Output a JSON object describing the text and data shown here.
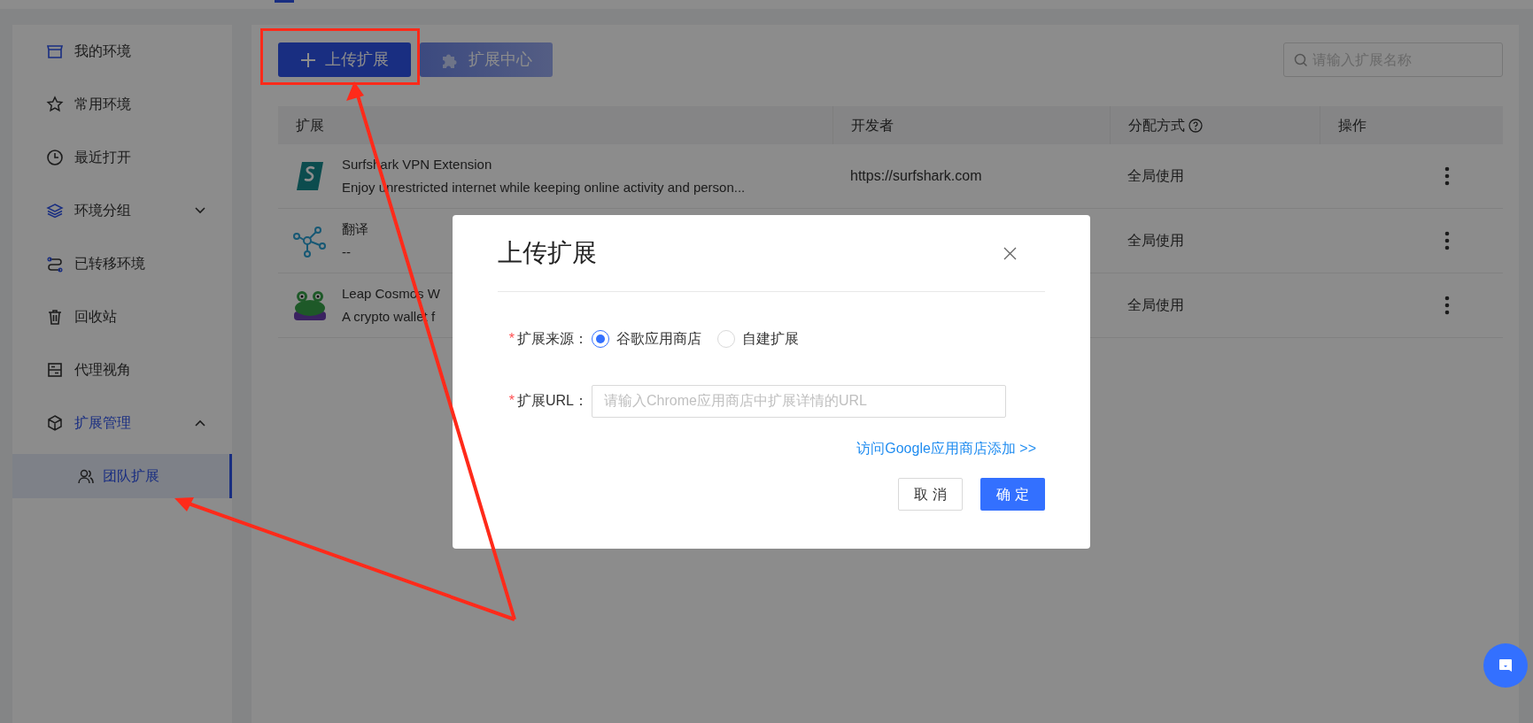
{
  "sidebar": {
    "items": [
      {
        "label": "我的环境",
        "selected": false
      },
      {
        "label": "常用环境",
        "selected": false
      },
      {
        "label": "最近打开",
        "selected": false
      },
      {
        "label": "环境分组",
        "selected": false,
        "expanded": false
      },
      {
        "label": "已转移环境",
        "selected": false
      },
      {
        "label": "回收站",
        "selected": false
      },
      {
        "label": "代理视角",
        "selected": false
      },
      {
        "label": "扩展管理",
        "selected": true,
        "expanded": true,
        "children": [
          {
            "label": "团队扩展",
            "selected": true,
            "marked": true
          }
        ]
      }
    ]
  },
  "toolbar": {
    "buttons": [
      {
        "label": "上传扩展",
        "kind": "primary",
        "marked": true
      },
      {
        "label": "扩展中心",
        "kind": "gradient"
      }
    ],
    "search": {
      "placeholder": "请输入扩展名称"
    }
  },
  "table": {
    "columns": [
      {
        "label": "扩展"
      },
      {
        "label": "开发者"
      },
      {
        "label": "分配方式",
        "help": true
      },
      {
        "label": "操作"
      }
    ],
    "rows": [
      {
        "name": "Surfshark VPN Extension",
        "description": "Enjoy unrestricted internet while keeping online activity and person...",
        "developer": "https://surfshark.com",
        "assignment": "全局使用"
      },
      {
        "name": "翻译",
        "description": "--",
        "assignment": "全局使用"
      },
      {
        "name": "Leap Cosmos W",
        "description": "A crypto wallet f",
        "assignment": "全局使用"
      }
    ]
  },
  "dialog": {
    "title": "上传扩展",
    "source": {
      "label": "扩展来源：",
      "required_mark": "*",
      "options": [
        {
          "label": "谷歌应用商店",
          "selected": true
        },
        {
          "label": "自建扩展",
          "selected": false
        }
      ]
    },
    "url": {
      "label": "扩展URL：",
      "required_mark": "*",
      "placeholder": "请输入Chrome应用商店中扩展详情的URL"
    },
    "link": "访问Google应用商店添加 >>",
    "buttons": [
      {
        "label": "取 消",
        "kind": "default"
      },
      {
        "label": "确 定",
        "kind": "primary"
      }
    ]
  }
}
